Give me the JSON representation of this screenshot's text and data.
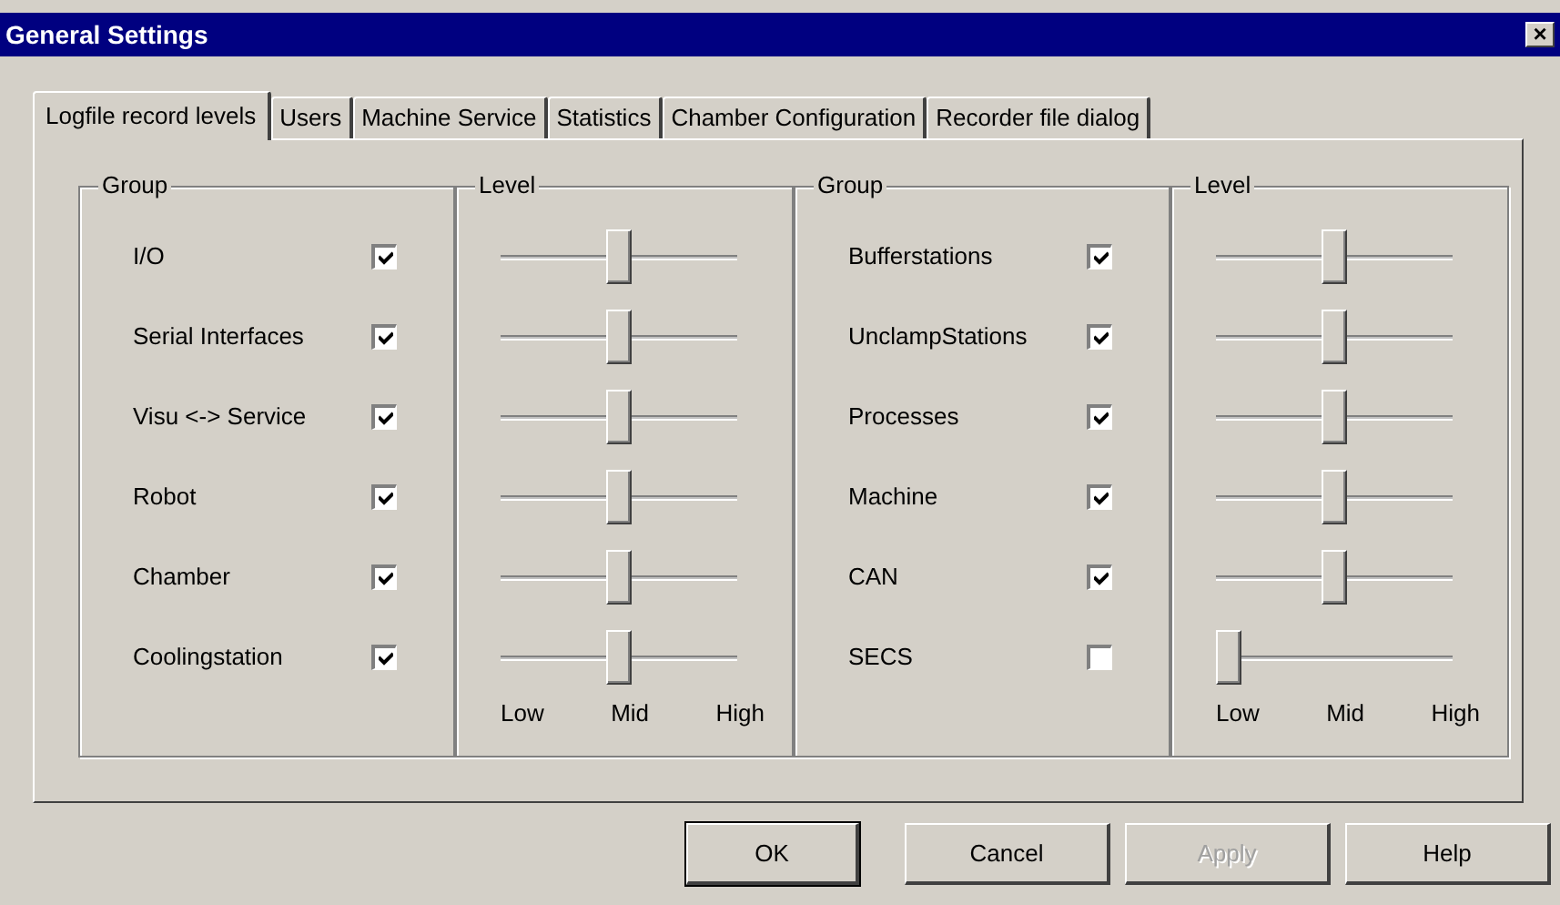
{
  "window": {
    "title": "General Settings",
    "close": "×"
  },
  "tabs": [
    {
      "label": "Logfile record levels",
      "selected": true
    },
    {
      "label": "Users",
      "selected": false
    },
    {
      "label": "Machine Service",
      "selected": false
    },
    {
      "label": "Statistics",
      "selected": false
    },
    {
      "label": "Chamber Configuration",
      "selected": false
    },
    {
      "label": "Recorder file dialog",
      "selected": false
    }
  ],
  "panels": [
    {
      "group_heading": "Group",
      "level_heading": "Level",
      "scale": [
        "Low",
        "Mid",
        "High"
      ],
      "rows": [
        {
          "name": "I/O",
          "checked": true,
          "level": 0.5
        },
        {
          "name": "Serial Interfaces",
          "checked": true,
          "level": 0.5
        },
        {
          "name": "Visu <-> Service",
          "checked": true,
          "level": 0.5
        },
        {
          "name": "Robot",
          "checked": true,
          "level": 0.5
        },
        {
          "name": "Chamber",
          "checked": true,
          "level": 0.5
        },
        {
          "name": "Coolingstation",
          "checked": true,
          "level": 0.5
        }
      ]
    },
    {
      "group_heading": "Group",
      "level_heading": "Level",
      "scale": [
        "Low",
        "Mid",
        "High"
      ],
      "rows": [
        {
          "name": "Bufferstations",
          "checked": true,
          "level": 0.5
        },
        {
          "name": "UnclampStations",
          "checked": true,
          "level": 0.5
        },
        {
          "name": "Processes",
          "checked": true,
          "level": 0.5
        },
        {
          "name": "Machine",
          "checked": true,
          "level": 0.5
        },
        {
          "name": "CAN",
          "checked": true,
          "level": 0.5
        },
        {
          "name": "SECS",
          "checked": false,
          "level": 0
        }
      ]
    }
  ],
  "buttons": [
    {
      "label": "OK",
      "disabled": false,
      "default": true
    },
    {
      "label": "Cancel",
      "disabled": false,
      "default": false
    },
    {
      "label": "Apply",
      "disabled": true,
      "default": false
    },
    {
      "label": "Help",
      "disabled": false,
      "default": false
    }
  ]
}
